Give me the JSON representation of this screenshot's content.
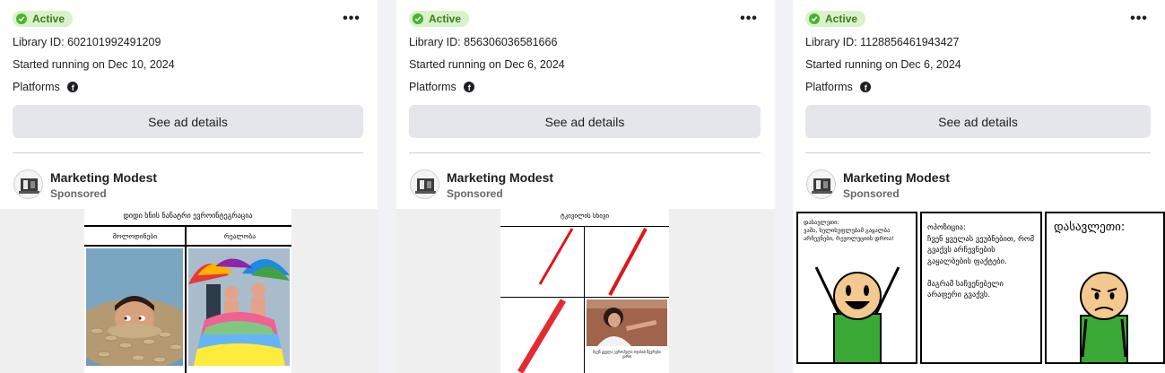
{
  "cards": [
    {
      "status": "Active",
      "library_id": "Library ID: 602101992491209",
      "started": "Started running on Dec 10, 2024",
      "platforms_label": "Platforms",
      "details_button": "See ad details",
      "page_name": "Marketing Modest",
      "sponsored": "Sponsored",
      "image": {
        "title": "დიდი ხნის ნანატრი ევროინტეგრაცია",
        "left_header": "მოლოდინები",
        "right_header": "რეალობა"
      }
    },
    {
      "status": "Active",
      "library_id": "Library ID: 856306036581666",
      "started": "Started running on Dec 6, 2024",
      "platforms_label": "Platforms",
      "details_button": "See ad details",
      "page_name": "Marketing Modest",
      "sponsored": "Sponsored",
      "image": {
        "title": "ტკივილის სხივი",
        "caption": "ჩვენ ყველა ევროპული ოჯახის წევრები ვართ"
      }
    },
    {
      "status": "Active",
      "library_id": "Library ID: 1128856461943427",
      "started": "Started running on Dec 6, 2024",
      "platforms_label": "Platforms",
      "details_button": "See ad details",
      "page_name": "Marketing Modest",
      "sponsored": "Sponsored",
      "image": {
        "panel1_text": "დასავლეთი:\nვაშა, ხელისუფლებამ გაყალბა არჩევნები, რევოლუციის დროა!",
        "panel2_text": "ოპოზიცია:\nჩვენ ყველას ვეუბნებით, რომ გვაქვს არჩევნების გაყალბების ფაქტები.\n\nმაგრამ საჩვენებელი არაფერი გვაქვს.",
        "panel3_text": "დასავლეთი:"
      }
    }
  ]
}
